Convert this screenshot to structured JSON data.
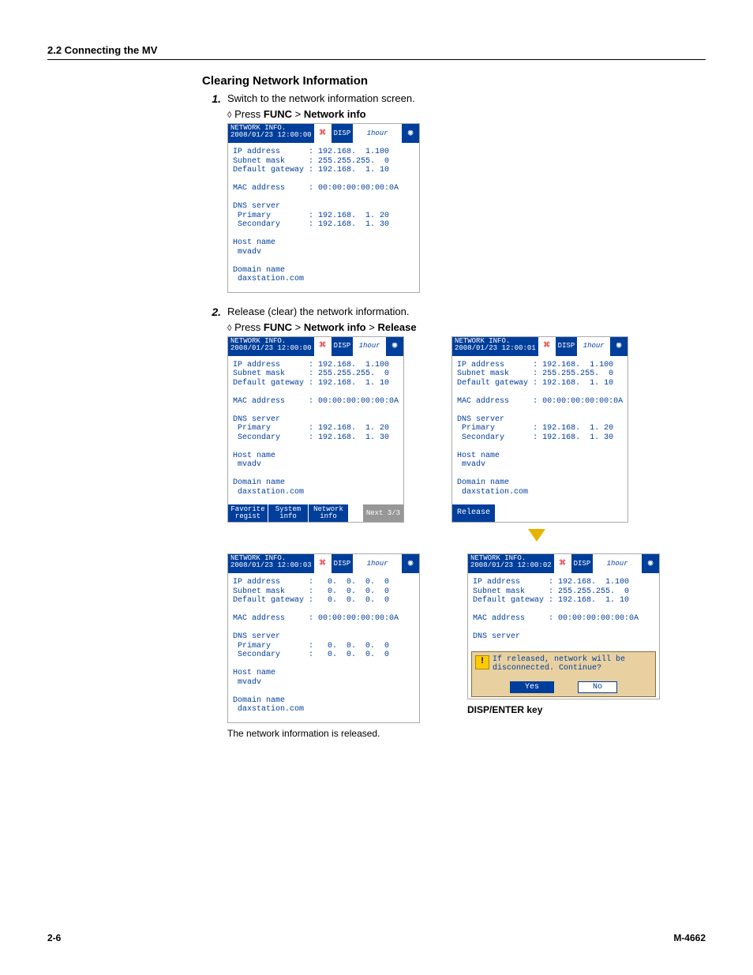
{
  "header": {
    "section": "2.2  Connecting the MV"
  },
  "title": "Clearing Network Information",
  "steps": {
    "s1": {
      "num": "1.",
      "text": "Switch to the network information screen."
    },
    "s2": {
      "num": "2.",
      "text": "Release (clear) the network information."
    }
  },
  "instr": {
    "diamond": "◊",
    "press": "Press",
    "func": "FUNC",
    "sep": ">",
    "netinfo": "Network info",
    "release": "Release"
  },
  "titlebar": {
    "title": "NETWORK INFO.",
    "ts00": "2008/01/23 12:00:00",
    "ts01": "2008/01/23 12:00:01",
    "ts02": "2008/01/23 12:00:02",
    "ts03": "2008/01/23 12:00:03",
    "disp": "DISP",
    "time": "1hour"
  },
  "net": {
    "full": "IP address      : 192.168.  1.100\nSubnet mask     : 255.255.255.  0\nDefault gateway : 192.168.  1. 10\n\nMAC address     : 00:00:00:00:00:0A\n\nDNS server\n Primary        : 192.168.  1. 20\n Secondary      : 192.168.  1. 30\n\nHost name\n mvadv\n\nDomain name\n daxstation.com",
    "zero": "IP address      :   0.  0.  0.  0\nSubnet mask     :   0.  0.  0.  0\nDefault gateway :   0.  0.  0.  0\n\nMAC address     : 00:00:00:00:00:0A\n\nDNS server\n Primary        :   0.  0.  0.  0\n Secondary      :   0.  0.  0.  0\n\nHost name\n mvadv\n\nDomain name\n daxstation.com",
    "partial": "IP address      : 192.168.  1.100\nSubnet mask     : 255.255.255.  0\nDefault gateway : 192.168.  1. 10\n\nMAC address     : 00:00:00:00:00:0A\n\nDNS server"
  },
  "softkeys": {
    "fav1": "Favorite",
    "fav2": "regist",
    "sys1": "System",
    "sys2": "info",
    "net1": "Network",
    "net2": "info",
    "next": "Next 3/3",
    "release": "Release"
  },
  "dialog": {
    "msg1": "If released, network will be",
    "msg2": "disconnected. Continue?",
    "yes": "Yes",
    "no": "No"
  },
  "captions": {
    "released": "The network information is released.",
    "dispenter": "DISP/ENTER key"
  },
  "footer": {
    "page": "2-6",
    "doc": "M-4662"
  }
}
